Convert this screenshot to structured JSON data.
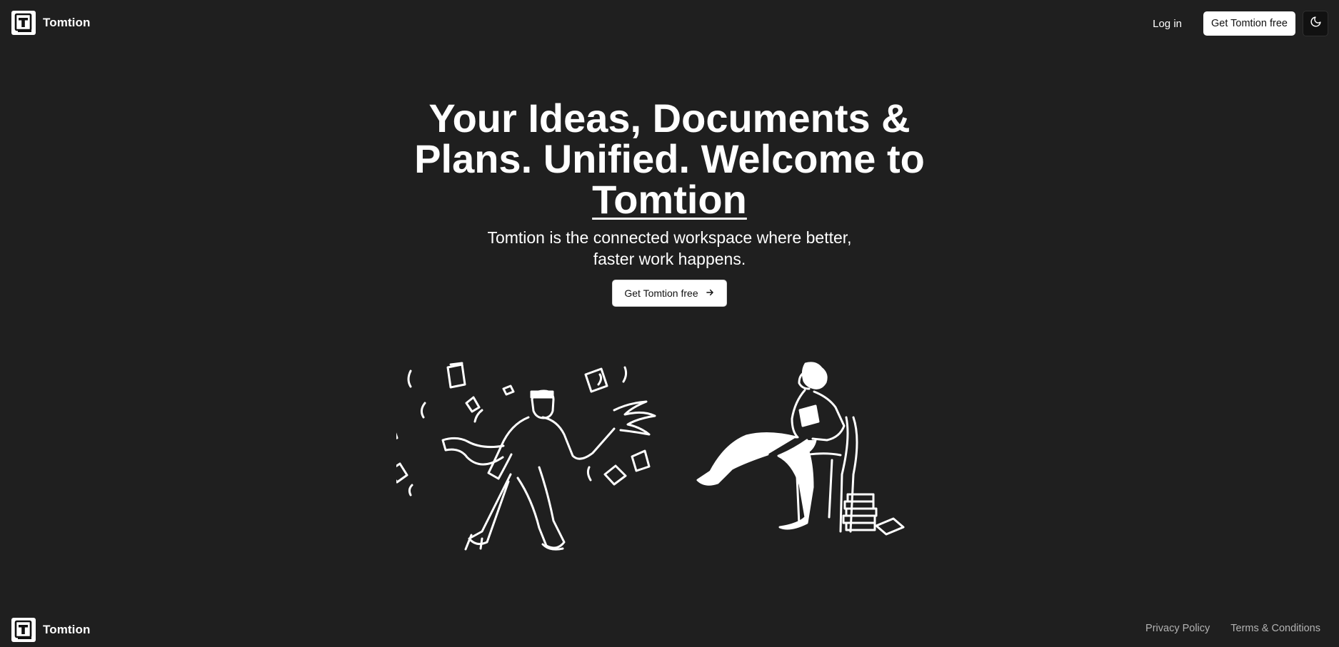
{
  "header": {
    "brand_name": "Tomtion",
    "login_label": "Log in",
    "get_free_label": "Get Tomtion free",
    "theme_toggle_icon": "moon-icon"
  },
  "hero": {
    "headline_part1": "Your Ideas, Documents & Plans. Unified. Welcome to ",
    "headline_brand": "Tomtion",
    "subheadline": "Tomtion is the connected workspace where better, faster work happens.",
    "cta_label": "Get Tomtion free",
    "cta_icon": "arrow-right-icon"
  },
  "illustration": {
    "left_figure": "juggling-papers-person",
    "right_figure": "reading-person-on-chair"
  },
  "footer": {
    "brand_name": "Tomtion",
    "links": [
      "Privacy Policy",
      "Terms & Conditions"
    ]
  },
  "colors": {
    "background": "#1f1f1f",
    "text": "#ffffff",
    "button_bg": "#ffffff",
    "button_text": "#111111",
    "muted_link": "#b3b3b3"
  }
}
